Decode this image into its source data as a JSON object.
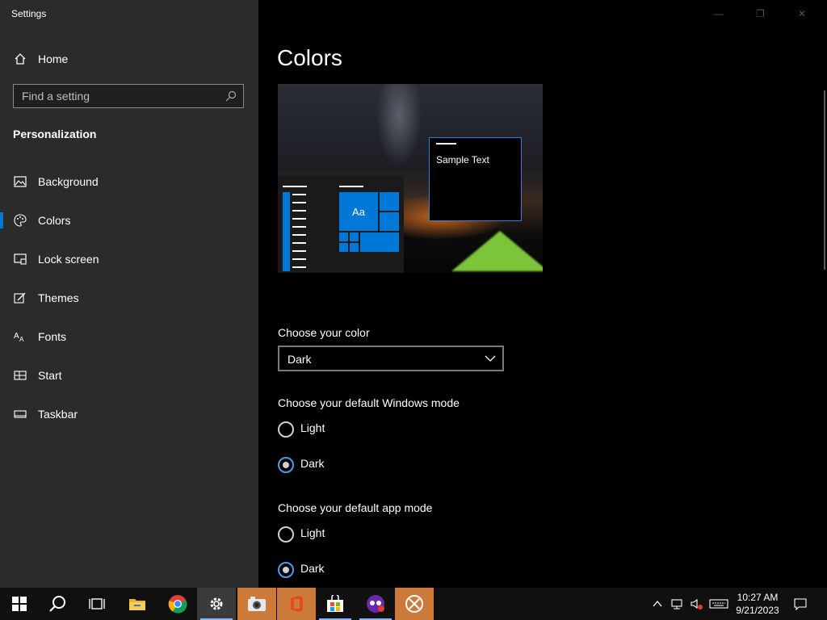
{
  "window": {
    "title": "Settings"
  },
  "sidebar": {
    "home_label": "Home",
    "search_placeholder": "Find a setting",
    "section_title": "Personalization",
    "items": [
      {
        "label": "Background",
        "icon": "picture-icon"
      },
      {
        "label": "Colors",
        "icon": "palette-icon",
        "active": true
      },
      {
        "label": "Lock screen",
        "icon": "lock-screen-icon"
      },
      {
        "label": "Themes",
        "icon": "brush-icon"
      },
      {
        "label": "Fonts",
        "icon": "font-icon"
      },
      {
        "label": "Start",
        "icon": "start-icon"
      },
      {
        "label": "Taskbar",
        "icon": "taskbar-icon"
      }
    ]
  },
  "main": {
    "title": "Colors",
    "preview": {
      "sample_text": "Sample Text",
      "tile_label": "Aa"
    },
    "choose_color": {
      "label": "Choose your color",
      "selected": "Dark"
    },
    "windows_mode": {
      "label": "Choose your default Windows mode",
      "options": [
        "Light",
        "Dark"
      ],
      "selected": "Dark"
    },
    "app_mode": {
      "label": "Choose your default app mode",
      "options": [
        "Light",
        "Dark"
      ],
      "selected": "Dark"
    }
  },
  "taskbar": {
    "apps": [
      "start",
      "search",
      "task-view",
      "file-explorer",
      "chrome",
      "settings",
      "camera",
      "office",
      "store",
      "game-app",
      "xbox"
    ],
    "clock": {
      "time": "10:27 AM",
      "date": "9/21/2023"
    }
  },
  "colors": {
    "accent": "#0078d7",
    "sidebar_bg": "#2b2b2b",
    "taskbar_run": "#cc7a3a"
  }
}
